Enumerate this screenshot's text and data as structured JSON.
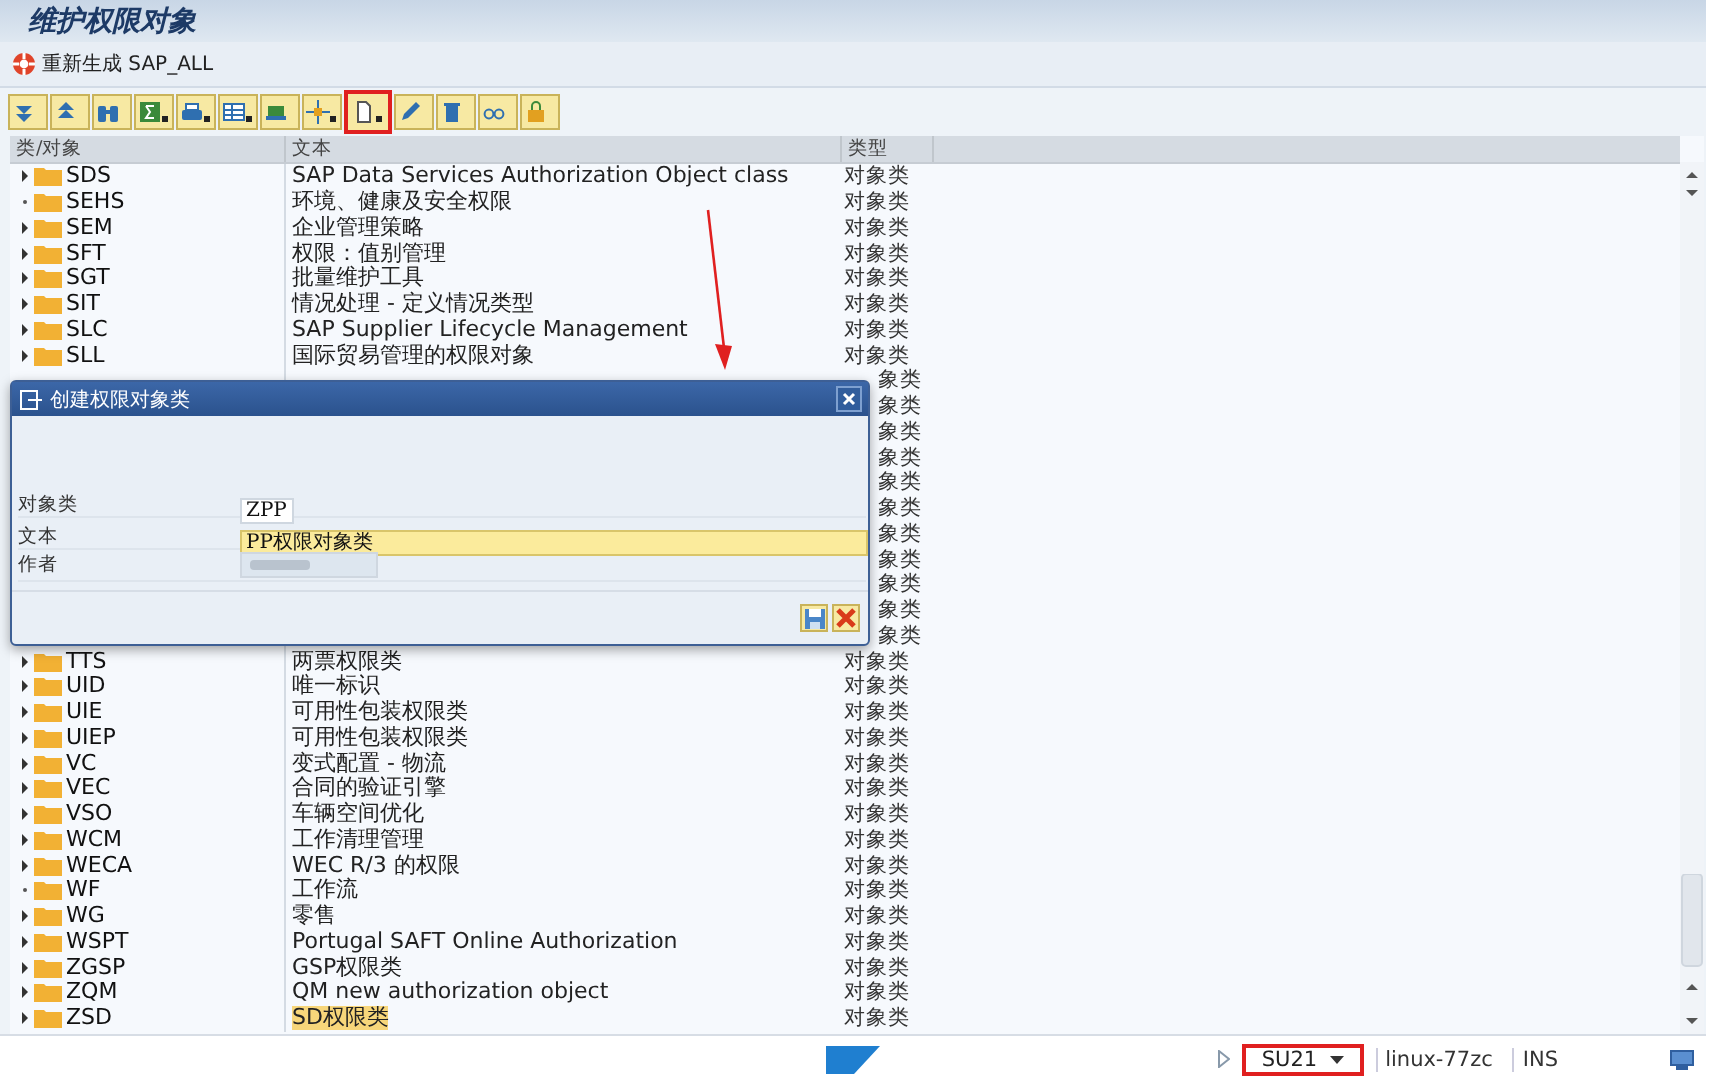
{
  "window": {
    "title": "维护权限对象"
  },
  "app_toolbar": {
    "label": "重新生成 SAP_ALL"
  },
  "toolbar": [
    {
      "kind": "expand",
      "menu": false,
      "highlighted": false
    },
    {
      "kind": "collapse",
      "menu": false,
      "highlighted": false
    },
    {
      "kind": "find",
      "menu": false,
      "highlighted": false
    },
    {
      "kind": "sum",
      "menu": true,
      "highlighted": false
    },
    {
      "kind": "print",
      "menu": true,
      "highlighted": false
    },
    {
      "kind": "layout",
      "menu": true,
      "highlighted": false
    },
    {
      "kind": "transport",
      "menu": false,
      "highlighted": false
    },
    {
      "kind": "move",
      "menu": true,
      "highlighted": false
    },
    {
      "kind": "create",
      "menu": true,
      "highlighted": true
    },
    {
      "kind": "edit",
      "menu": false,
      "highlighted": false
    },
    {
      "kind": "delete",
      "menu": false,
      "highlighted": false
    },
    {
      "kind": "display",
      "menu": false,
      "highlighted": false
    },
    {
      "kind": "lock",
      "menu": false,
      "highlighted": false
    }
  ],
  "table": {
    "columns": [
      "类/对象",
      "文本",
      "类型"
    ],
    "rows": [
      {
        "kind": "class",
        "name": "SDS",
        "text": "SAP Data Services Authorization Object class",
        "type": "对象类",
        "expandable": true,
        "highlighted": false
      },
      {
        "kind": "class",
        "name": "SEHS",
        "text": "环境、健康及安全权限",
        "type": "对象类",
        "expandable": false,
        "highlighted": false
      },
      {
        "kind": "class",
        "name": "SEM",
        "text": "企业管理策略",
        "type": "对象类",
        "expandable": true,
        "highlighted": false
      },
      {
        "kind": "class",
        "name": "SFT",
        "text": "权限：值别管理",
        "type": "对象类",
        "expandable": true,
        "highlighted": false
      },
      {
        "kind": "class",
        "name": "SGT",
        "text": "批量维护工具",
        "type": "对象类",
        "expandable": true,
        "highlighted": false
      },
      {
        "kind": "class",
        "name": "SIT",
        "text": "情况处理 - 定义情况类型",
        "type": "对象类",
        "expandable": true,
        "highlighted": false
      },
      {
        "kind": "class",
        "name": "SLC",
        "text": "SAP Supplier Lifecycle Management",
        "type": "对象类",
        "expandable": true,
        "highlighted": false
      },
      {
        "kind": "class",
        "name": "SLL",
        "text": "国际贸易管理的权限对象",
        "type": "对象类",
        "expandable": true,
        "highlighted": false
      },
      {
        "kind": "covered",
        "type": "象类"
      },
      {
        "kind": "covered",
        "type": "象类"
      },
      {
        "kind": "covered",
        "type": "象类"
      },
      {
        "kind": "covered",
        "type": "象类"
      },
      {
        "kind": "covered",
        "type": "象类"
      },
      {
        "kind": "covered",
        "type": "象类"
      },
      {
        "kind": "covered",
        "type": "象类"
      },
      {
        "kind": "covered",
        "type": "象类"
      },
      {
        "kind": "covered",
        "type": "象类"
      },
      {
        "kind": "covered",
        "type": "象类"
      },
      {
        "kind": "covered",
        "type": "象类"
      },
      {
        "kind": "class",
        "name": "TTS",
        "text": "两票权限类",
        "type": "对象类",
        "expandable": true,
        "highlighted": false
      },
      {
        "kind": "class",
        "name": "UID",
        "text": "唯一标识",
        "type": "对象类",
        "expandable": true,
        "highlighted": false
      },
      {
        "kind": "class",
        "name": "UIE",
        "text": "可用性包装权限类",
        "type": "对象类",
        "expandable": true,
        "highlighted": false
      },
      {
        "kind": "class",
        "name": "UIEP",
        "text": "可用性包装权限类",
        "type": "对象类",
        "expandable": true,
        "highlighted": false
      },
      {
        "kind": "class",
        "name": "VC",
        "text": "变式配置 - 物流",
        "type": "对象类",
        "expandable": true,
        "highlighted": false
      },
      {
        "kind": "class",
        "name": "VEC",
        "text": "合同的验证引擎",
        "type": "对象类",
        "expandable": true,
        "highlighted": false
      },
      {
        "kind": "class",
        "name": "VSO",
        "text": "车辆空间优化",
        "type": "对象类",
        "expandable": true,
        "highlighted": false
      },
      {
        "kind": "class",
        "name": "WCM",
        "text": "工作清理管理",
        "type": "对象类",
        "expandable": true,
        "highlighted": false
      },
      {
        "kind": "class",
        "name": "WECA",
        "text": "WEC R/3 的权限",
        "type": "对象类",
        "expandable": true,
        "highlighted": false
      },
      {
        "kind": "class",
        "name": "WF",
        "text": "工作流",
        "type": "对象类",
        "expandable": false,
        "highlighted": false
      },
      {
        "kind": "class",
        "name": "WG",
        "text": "零售",
        "type": "对象类",
        "expandable": true,
        "highlighted": false
      },
      {
        "kind": "class",
        "name": "WSPT",
        "text": "Portugal SAFT Online Authorization",
        "type": "对象类",
        "expandable": true,
        "highlighted": false
      },
      {
        "kind": "class",
        "name": "ZGSP",
        "text": "GSP权限类",
        "type": "对象类",
        "expandable": true,
        "highlighted": false
      },
      {
        "kind": "class",
        "name": "ZQM",
        "text": "QM new authorization object",
        "type": "对象类",
        "expandable": true,
        "highlighted": false
      },
      {
        "kind": "class",
        "name": "ZSD",
        "text": "SD权限类",
        "type": "对象类",
        "expandable": true,
        "highlighted": true
      }
    ]
  },
  "dialog": {
    "title": "创建权限对象类",
    "fields": [
      {
        "kind": "short",
        "label": "对象类",
        "value": "ZPP",
        "focused": false
      },
      {
        "kind": "long",
        "label": "文本",
        "value": "PP权限对象类",
        "focused": true
      },
      {
        "kind": "blurred",
        "label": "作者",
        "focused": false
      }
    ]
  },
  "status_bar": {
    "transaction": "SU21",
    "transaction_highlighted": true,
    "server": "linux-77zc",
    "mode": "INS"
  }
}
